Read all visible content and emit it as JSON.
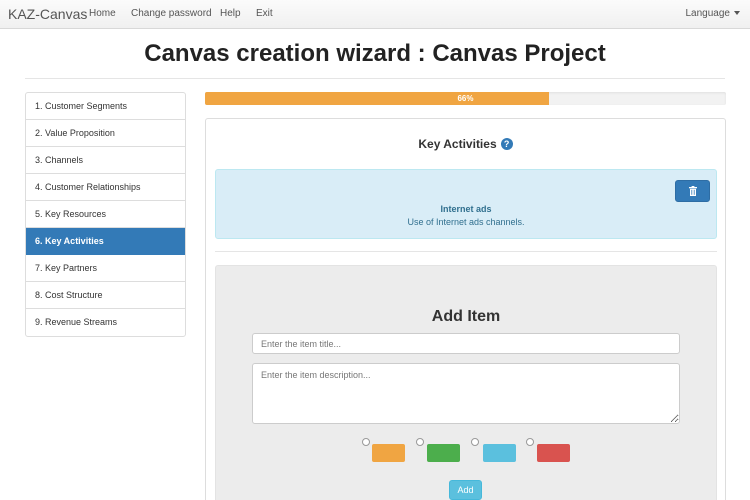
{
  "navbar": {
    "brand": "KAZ-Canvas",
    "links": [
      "Home",
      "Change password",
      "Help",
      "Exit"
    ],
    "language": "Language"
  },
  "page_title": "Canvas creation wizard : Canvas Project",
  "sidebar": {
    "items": [
      {
        "label": "1. Customer Segments"
      },
      {
        "label": "2. Value Proposition"
      },
      {
        "label": "3. Channels"
      },
      {
        "label": "4. Customer Relationships"
      },
      {
        "label": "5. Key Resources"
      },
      {
        "label": "6. Key Activities",
        "active": true
      },
      {
        "label": "7. Key Partners"
      },
      {
        "label": "8. Cost Structure"
      },
      {
        "label": "9. Revenue Streams"
      }
    ]
  },
  "progress": {
    "value": 66,
    "label": "66%",
    "color": "#f0a542"
  },
  "section": {
    "title": "Key Activities",
    "help_icon": "question-circle-icon"
  },
  "item": {
    "title": "Internet ads",
    "description": "Use of Internet ads channels.",
    "delete_icon": "trash-icon"
  },
  "add_form": {
    "title": "Add Item",
    "title_placeholder": "Enter the item title...",
    "description_placeholder": "Enter the item description...",
    "colors": [
      "#f0a542",
      "#4cae4c",
      "#5bc0de",
      "#d9534f"
    ],
    "add_label": "Add"
  },
  "colors": {
    "primary": "#337ab7",
    "info_bg": "#d9edf7",
    "info_text": "#31708f"
  }
}
